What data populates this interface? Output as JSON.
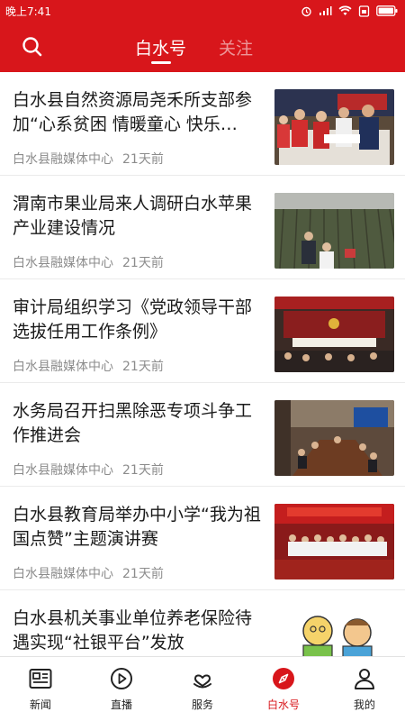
{
  "status_bar": {
    "time": "晚上7:41"
  },
  "header": {
    "tabs": [
      {
        "label": "白水号",
        "active": true
      },
      {
        "label": "关注",
        "active": false
      }
    ]
  },
  "articles": [
    {
      "title": "白水县自然资源局尧禾所支部参加“心系贫困 情暖童心 快乐…",
      "source": "白水县融媒体中心",
      "time": "21天前"
    },
    {
      "title": "渭南市果业局来人调研白水苹果产业建设情况",
      "source": "白水县融媒体中心",
      "time": "21天前"
    },
    {
      "title": "审计局组织学习《党政领导干部选拔任用工作条例》",
      "source": "白水县融媒体中心",
      "time": "21天前"
    },
    {
      "title": "水务局召开扫黑除恶专项斗争工作推进会",
      "source": "白水县融媒体中心",
      "time": "21天前"
    },
    {
      "title": "白水县教育局举办中小学“我为祖国点赞”主题演讲赛",
      "source": "白水县融媒体中心",
      "time": "21天前"
    },
    {
      "title": "白水县机关事业单位养老保险待遇实现“社银平台”发放",
      "source": "",
      "time": ""
    }
  ],
  "bottom_nav": [
    {
      "label": "新闻",
      "icon": "news-icon",
      "active": false
    },
    {
      "label": "直播",
      "icon": "play-icon",
      "active": false
    },
    {
      "label": "服务",
      "icon": "service-icon",
      "active": false
    },
    {
      "label": "白水号",
      "icon": "compass-icon",
      "active": true
    },
    {
      "label": "我的",
      "icon": "user-icon",
      "active": false
    }
  ],
  "colors": {
    "brand_red": "#d8161b",
    "meta_gray": "#8c8c8c"
  }
}
